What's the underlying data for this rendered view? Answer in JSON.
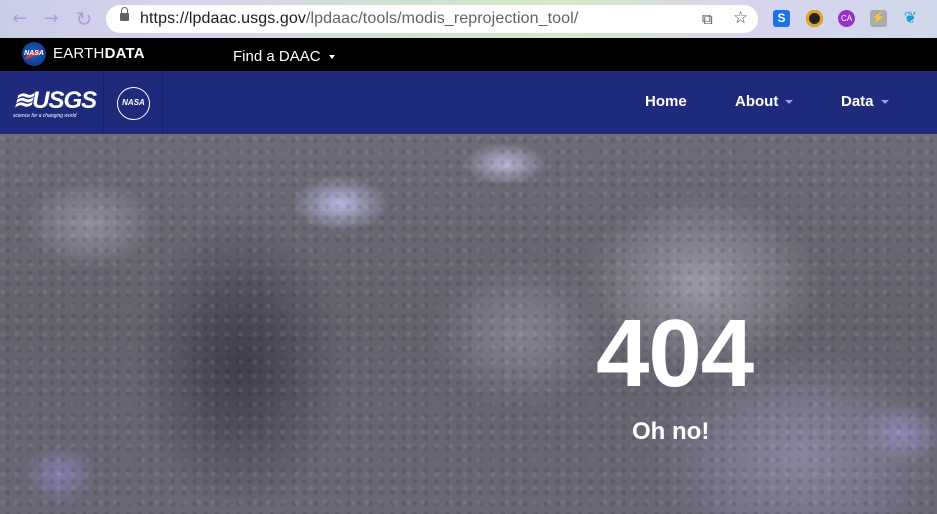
{
  "browser": {
    "url_host": "https://lpdaac.usgs.gov",
    "url_path": "/lpdaac/tools/modis_reprojection_tool/",
    "icons": [
      "back-icon",
      "forward-icon",
      "reload-icon",
      "lock-icon",
      "translate-icon",
      "star-icon"
    ],
    "extensions": [
      {
        "name": "s-extension-icon",
        "color": "#1a73e8",
        "glyph": "S"
      },
      {
        "name": "color-extension-icon",
        "color": "#222222",
        "glyph": "◉"
      },
      {
        "name": "ca-extension-icon",
        "color": "#9b30c8",
        "glyph": "CA"
      },
      {
        "name": "bolt-extension-icon",
        "color": "#9a9a9a",
        "glyph": "⚡"
      },
      {
        "name": "leaf-extension-icon",
        "color": "#1aa0c8",
        "glyph": "❦"
      }
    ]
  },
  "earthdata": {
    "brand_light": "EARTH",
    "brand_bold": "DATA",
    "find_daac": "Find a DAAC"
  },
  "site_nav": {
    "usgs_mark": "≋USGS",
    "usgs_tagline": "science for a changing world",
    "nasa_mark": "NASA",
    "links": [
      {
        "label": "Home"
      },
      {
        "label": "About"
      },
      {
        "label": "Data"
      }
    ],
    "bg_color": "#1f2a7c"
  },
  "hero": {
    "code": "404",
    "message": "Oh no!"
  }
}
